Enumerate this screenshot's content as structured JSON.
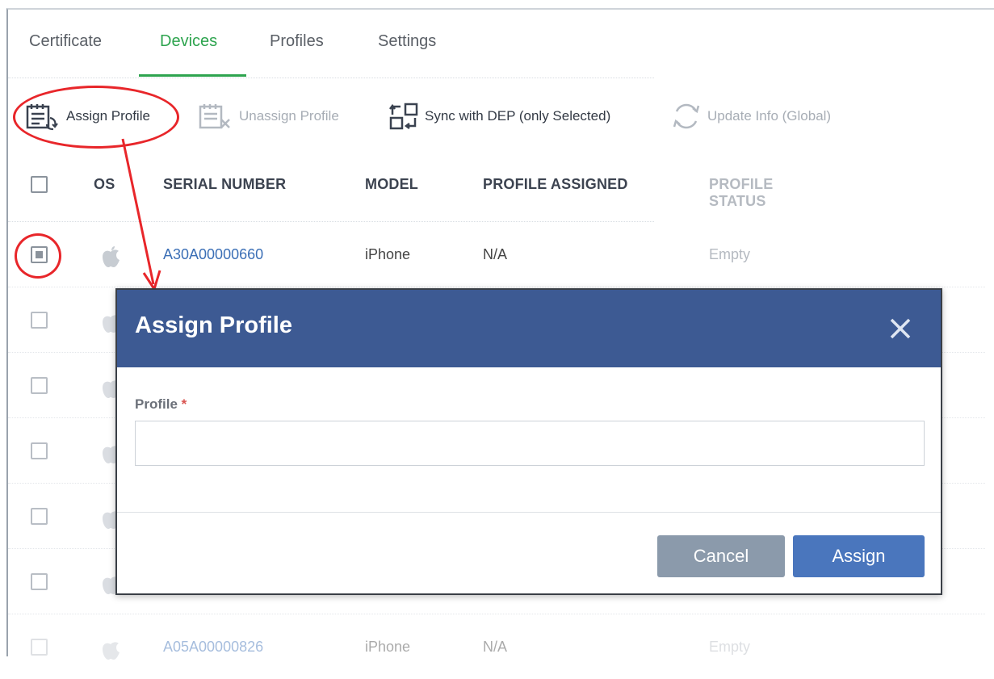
{
  "tabs": [
    {
      "label": "Certificate",
      "active": false
    },
    {
      "label": "Devices",
      "active": true
    },
    {
      "label": "Profiles",
      "active": false
    },
    {
      "label": "Settings",
      "active": false
    }
  ],
  "toolbar": {
    "assign_profile": "Assign Profile",
    "unassign_profile": "Unassign Profile",
    "sync_dep": "Sync with DEP (only Selected)",
    "update_info": "Update Info (Global)"
  },
  "table": {
    "headers": {
      "os": "OS",
      "serial": "SERIAL NUMBER",
      "model": "MODEL",
      "profile_assigned": "PROFILE ASSIGNED",
      "profile_status": "PROFILE STATUS"
    },
    "rows": [
      {
        "serial": "A30A00000660",
        "model": "iPhone",
        "profile_assigned": "N/A",
        "profile_status": "Empty",
        "checked": true
      },
      {
        "serial": "",
        "model": "",
        "profile_assigned": "",
        "profile_status": "",
        "checked": false
      },
      {
        "serial": "",
        "model": "",
        "profile_assigned": "",
        "profile_status": "",
        "checked": false
      },
      {
        "serial": "",
        "model": "",
        "profile_assigned": "",
        "profile_status": "",
        "checked": false
      },
      {
        "serial": "",
        "model": "",
        "profile_assigned": "",
        "profile_status": "",
        "checked": false
      },
      {
        "serial": "",
        "model": "",
        "profile_assigned": "",
        "profile_status": "",
        "checked": false
      },
      {
        "serial": "A05A00000826",
        "model": "iPhone",
        "profile_assigned": "N/A",
        "profile_status": "Empty",
        "checked": false
      }
    ]
  },
  "modal": {
    "title": "Assign Profile",
    "field_label": "Profile",
    "required_mark": "*",
    "field_value": "",
    "cancel": "Cancel",
    "assign": "Assign"
  },
  "colors": {
    "accent_green": "#2ea44f",
    "modal_header": "#3d5a93",
    "assign_button": "#4a76bd",
    "cancel_button": "#8b9aab",
    "link": "#3b6fb6",
    "annotation": "#e8262a"
  },
  "icons": {
    "assign": "assign-profile-icon",
    "unassign": "unassign-profile-icon",
    "sync": "sync-dep-icon",
    "update": "refresh-icon",
    "os": "apple-icon",
    "close": "close-icon"
  }
}
